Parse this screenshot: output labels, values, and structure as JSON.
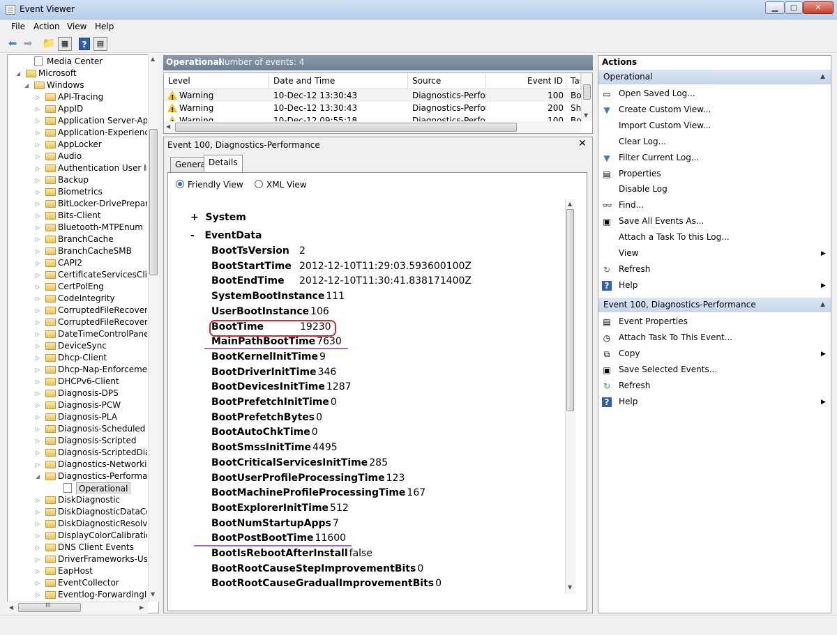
{
  "window": {
    "title": "Event Viewer"
  },
  "menu": [
    "File",
    "Action",
    "View",
    "Help"
  ],
  "tree": {
    "items": [
      {
        "label": "Media Center",
        "level": 1,
        "type": "log",
        "expand": ""
      },
      {
        "label": "Microsoft",
        "level": 0,
        "type": "folder",
        "expand": "◢"
      },
      {
        "label": "Windows",
        "level": 1,
        "type": "folder",
        "expand": "◢"
      },
      {
        "label": "API-Tracing",
        "level": 2,
        "type": "folder",
        "expand": "▷"
      },
      {
        "label": "AppID",
        "level": 2,
        "type": "folder",
        "expand": "▷"
      },
      {
        "label": "Application Server-Ap",
        "level": 2,
        "type": "folder",
        "expand": "▷"
      },
      {
        "label": "Application-Experienc",
        "level": 2,
        "type": "folder",
        "expand": "▷"
      },
      {
        "label": "AppLocker",
        "level": 2,
        "type": "folder",
        "expand": "▷"
      },
      {
        "label": "Audio",
        "level": 2,
        "type": "folder",
        "expand": "▷"
      },
      {
        "label": "Authentication User In",
        "level": 2,
        "type": "folder",
        "expand": "▷"
      },
      {
        "label": "Backup",
        "level": 2,
        "type": "folder",
        "expand": "▷"
      },
      {
        "label": "Biometrics",
        "level": 2,
        "type": "folder",
        "expand": "▷"
      },
      {
        "label": "BitLocker-DrivePrepar",
        "level": 2,
        "type": "folder",
        "expand": "▷"
      },
      {
        "label": "Bits-Client",
        "level": 2,
        "type": "folder",
        "expand": "▷"
      },
      {
        "label": "Bluetooth-MTPEnum",
        "level": 2,
        "type": "folder",
        "expand": "▷"
      },
      {
        "label": "BranchCache",
        "level": 2,
        "type": "folder",
        "expand": "▷"
      },
      {
        "label": "BranchCacheSMB",
        "level": 2,
        "type": "folder",
        "expand": "▷"
      },
      {
        "label": "CAPI2",
        "level": 2,
        "type": "folder",
        "expand": "▷"
      },
      {
        "label": "CertificateServicesClie",
        "level": 2,
        "type": "folder",
        "expand": "▷"
      },
      {
        "label": "CertPolEng",
        "level": 2,
        "type": "folder",
        "expand": "▷"
      },
      {
        "label": "CodeIntegrity",
        "level": 2,
        "type": "folder",
        "expand": "▷"
      },
      {
        "label": "CorruptedFileRecover",
        "level": 2,
        "type": "folder",
        "expand": "▷"
      },
      {
        "label": "CorruptedFileRecover",
        "level": 2,
        "type": "folder",
        "expand": "▷"
      },
      {
        "label": "DateTimeControlPane",
        "level": 2,
        "type": "folder",
        "expand": "▷"
      },
      {
        "label": "DeviceSync",
        "level": 2,
        "type": "folder",
        "expand": "▷"
      },
      {
        "label": "Dhcp-Client",
        "level": 2,
        "type": "folder",
        "expand": "▷"
      },
      {
        "label": "Dhcp-Nap-Enforceme",
        "level": 2,
        "type": "folder",
        "expand": "▷"
      },
      {
        "label": "DHCPv6-Client",
        "level": 2,
        "type": "folder",
        "expand": "▷"
      },
      {
        "label": "Diagnosis-DPS",
        "level": 2,
        "type": "folder",
        "expand": "▷"
      },
      {
        "label": "Diagnosis-PCW",
        "level": 2,
        "type": "folder",
        "expand": "▷"
      },
      {
        "label": "Diagnosis-PLA",
        "level": 2,
        "type": "folder",
        "expand": "▷"
      },
      {
        "label": "Diagnosis-Scheduled",
        "level": 2,
        "type": "folder",
        "expand": "▷"
      },
      {
        "label": "Diagnosis-Scripted",
        "level": 2,
        "type": "folder",
        "expand": "▷"
      },
      {
        "label": "Diagnosis-ScriptedDia",
        "level": 2,
        "type": "folder",
        "expand": "▷"
      },
      {
        "label": "Diagnostics-Networki",
        "level": 2,
        "type": "folder",
        "expand": "▷"
      },
      {
        "label": "Diagnostics-Performa",
        "level": 2,
        "type": "folder",
        "expand": "◢"
      },
      {
        "label": "Operational",
        "level": 3,
        "type": "log",
        "expand": "",
        "selected": true
      },
      {
        "label": "DiskDiagnostic",
        "level": 2,
        "type": "folder",
        "expand": "▷"
      },
      {
        "label": "DiskDiagnosticDataCo",
        "level": 2,
        "type": "folder",
        "expand": "▷"
      },
      {
        "label": "DiskDiagnosticResolv",
        "level": 2,
        "type": "folder",
        "expand": "▷"
      },
      {
        "label": "DisplayColorCalibratio",
        "level": 2,
        "type": "folder",
        "expand": "▷"
      },
      {
        "label": "DNS Client Events",
        "level": 2,
        "type": "folder",
        "expand": "▷"
      },
      {
        "label": "DriverFrameworks-Us",
        "level": 2,
        "type": "folder",
        "expand": "▷"
      },
      {
        "label": "EapHost",
        "level": 2,
        "type": "folder",
        "expand": "▷"
      },
      {
        "label": "EventCollector",
        "level": 2,
        "type": "folder",
        "expand": "▷"
      },
      {
        "label": "Eventlog-ForwardingI",
        "level": 2,
        "type": "folder",
        "expand": "▷"
      }
    ],
    "hscroll_label": "III"
  },
  "center": {
    "title": "Operational",
    "count": "Number of events: 4",
    "columns": [
      "Level",
      "Date and Time",
      "Source",
      "Event ID",
      "Tas"
    ],
    "rows": [
      {
        "level": "Warning",
        "date": "10-Dec-12 13:30:43",
        "source": "Diagnostics-Perfor...",
        "id": "100",
        "task": "Boo"
      },
      {
        "level": "Warning",
        "date": "10-Dec-12 13:30:43",
        "source": "Diagnostics-Perfor...",
        "id": "200",
        "task": "Shu"
      },
      {
        "level": "Warning",
        "date": "10-Dec-12 09:55:18",
        "source": "Diagnostics-Perfor...",
        "id": "100",
        "task": "Boo"
      }
    ]
  },
  "detail": {
    "title": "Event 100, Diagnostics-Performance",
    "tabs": [
      "General",
      "Details"
    ],
    "view_friendly": "Friendly View",
    "view_xml": "XML View",
    "system_label": "System",
    "eventdata_label": "EventData",
    "fields": [
      {
        "key": "BootTsVersion",
        "value": "2",
        "gap": true
      },
      {
        "key": "BootStartTime",
        "value": "2012-12-10T11:29:03.593600100Z",
        "gap": true
      },
      {
        "key": "BootEndTime",
        "value": "2012-12-10T11:30:41.838171400Z",
        "gap": true
      },
      {
        "key": "SystemBootInstance",
        "value": "111"
      },
      {
        "key": "UserBootInstance",
        "value": "106"
      },
      {
        "key": "BootTime",
        "value": "19230",
        "gap": true
      },
      {
        "key": "MainPathBootTime",
        "value": "7630"
      },
      {
        "key": "BootKernelInitTime",
        "value": "9"
      },
      {
        "key": "BootDriverInitTime",
        "value": "346"
      },
      {
        "key": "BootDevicesInitTime",
        "value": "1287"
      },
      {
        "key": "BootPrefetchInitTime",
        "value": "0"
      },
      {
        "key": "BootPrefetchBytes",
        "value": "0"
      },
      {
        "key": "BootAutoChkTime",
        "value": "0"
      },
      {
        "key": "BootSmssInitTime",
        "value": "4495"
      },
      {
        "key": "BootCriticalServicesInitTime",
        "value": "285"
      },
      {
        "key": "BootUserProfileProcessingTime",
        "value": "123"
      },
      {
        "key": "BootMachineProfileProcessingTime",
        "value": "167"
      },
      {
        "key": "BootExplorerInitTime",
        "value": "512"
      },
      {
        "key": "BootNumStartupApps",
        "value": "7"
      },
      {
        "key": "BootPostBootTime",
        "value": "11600"
      },
      {
        "key": "BootIsRebootAfterInstall",
        "value": "false"
      },
      {
        "key": "BootRootCauseStepImprovementBits",
        "value": "0"
      },
      {
        "key": "BootRootCauseGradualImprovementBits",
        "value": "0"
      }
    ]
  },
  "actions": {
    "title": "Actions",
    "section1": "Operational",
    "items1": [
      {
        "label": "Open Saved Log...",
        "icon": "open-log-icon"
      },
      {
        "label": "Create Custom View...",
        "icon": "filter-icon"
      },
      {
        "label": "Import Custom View...",
        "icon": ""
      },
      {
        "label": "Clear Log...",
        "icon": ""
      },
      {
        "label": "Filter Current Log...",
        "icon": "filter-icon"
      },
      {
        "label": "Properties",
        "icon": "properties-icon"
      },
      {
        "label": "Disable Log",
        "icon": ""
      },
      {
        "label": "Find...",
        "icon": "find-icon"
      },
      {
        "label": "Save All Events As...",
        "icon": "save-icon"
      },
      {
        "label": "Attach a Task To this Log...",
        "icon": ""
      },
      {
        "label": "View",
        "icon": "",
        "submenu": true
      },
      {
        "label": "Refresh",
        "icon": "refresh-icon"
      },
      {
        "label": "Help",
        "icon": "help-icon",
        "submenu": true
      }
    ],
    "section2": "Event 100, Diagnostics-Performance",
    "items2": [
      {
        "label": "Event Properties",
        "icon": "event-properties-icon"
      },
      {
        "label": "Attach Task To This Event...",
        "icon": "attach-task-icon"
      },
      {
        "label": "Copy",
        "icon": "copy-icon",
        "submenu": true
      },
      {
        "label": "Save Selected Events...",
        "icon": "save-icon"
      },
      {
        "label": "Refresh",
        "icon": "refresh-icon"
      },
      {
        "label": "Help",
        "icon": "help-icon",
        "submenu": true
      }
    ]
  },
  "colors": {
    "accent": "#1b6fd1",
    "highlight_circle": "#d12c2c",
    "underline": "#a06bc7",
    "warning": "#f2c418"
  }
}
